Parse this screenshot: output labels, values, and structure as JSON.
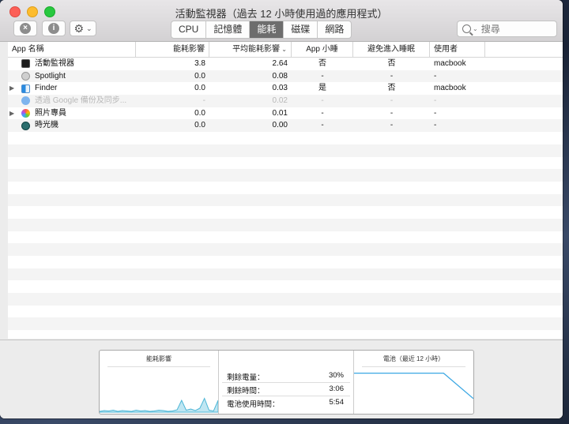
{
  "window": {
    "title": "活動監視器（過去 12 小時使用過的應用程式）"
  },
  "toolbar": {
    "stop_icon": "x-icon",
    "info_icon": "info-icon",
    "gear_icon": "gear-icon"
  },
  "tabs": [
    {
      "label": "CPU",
      "active": false
    },
    {
      "label": "記憶體",
      "active": false
    },
    {
      "label": "能耗",
      "active": true
    },
    {
      "label": "磁碟",
      "active": false
    },
    {
      "label": "網路",
      "active": false
    }
  ],
  "search": {
    "placeholder": "搜尋"
  },
  "table": {
    "columns": [
      "App 名稱",
      "能耗影響",
      "平均能耗影響",
      "App 小睡",
      "避免進入睡眠",
      "使用者"
    ],
    "rows": [
      {
        "name": "活動監視器",
        "icon": "activity-monitor-icon",
        "disclosure": "",
        "impact": "3.8",
        "avg": "2.64",
        "nap": "否",
        "prevent": "否",
        "user": "macbook",
        "dim": false
      },
      {
        "name": "Spotlight",
        "icon": "spotlight-icon",
        "disclosure": "",
        "impact": "0.0",
        "avg": "0.08",
        "nap": "-",
        "prevent": "-",
        "user": "-",
        "dim": false
      },
      {
        "name": "Finder",
        "icon": "finder-icon",
        "disclosure": "▶",
        "impact": "0.0",
        "avg": "0.03",
        "nap": "是",
        "prevent": "否",
        "user": "macbook",
        "dim": false
      },
      {
        "name": "透過 Google 備份及同步...",
        "icon": "google-backup-icon",
        "disclosure": "",
        "impact": "-",
        "avg": "0.02",
        "nap": "-",
        "prevent": "-",
        "user": "-",
        "dim": true
      },
      {
        "name": "照片專員",
        "icon": "photos-agent-icon",
        "disclosure": "▶",
        "impact": "0.0",
        "avg": "0.01",
        "nap": "-",
        "prevent": "-",
        "user": "-",
        "dim": false
      },
      {
        "name": "時光機",
        "icon": "time-machine-icon",
        "disclosure": "",
        "impact": "0.0",
        "avg": "0.00",
        "nap": "-",
        "prevent": "-",
        "user": "-",
        "dim": false
      }
    ]
  },
  "summary": {
    "impact_title": "能耗影響",
    "stats": [
      {
        "label": "剩餘電量：",
        "value": "30%"
      },
      {
        "label": "剩餘時間：",
        "value": "3:06"
      },
      {
        "label": "電池使用時間：",
        "value": "5:54"
      }
    ],
    "battery_title": "電池（最近 12 小時）",
    "battery_levels": [
      0.95,
      0.95,
      0.95,
      0.95,
      0.33
    ],
    "impact_levels": [
      0.02,
      0.04,
      0.03,
      0.05,
      0.02,
      0.04,
      0.03,
      0.02,
      0.05,
      0.03,
      0.04,
      0.02,
      0.03,
      0.05,
      0.04,
      0.02,
      0.03,
      0.06,
      0.3,
      0.05,
      0.08,
      0.04,
      0.1,
      0.35,
      0.05,
      0.03,
      0.3
    ]
  }
}
